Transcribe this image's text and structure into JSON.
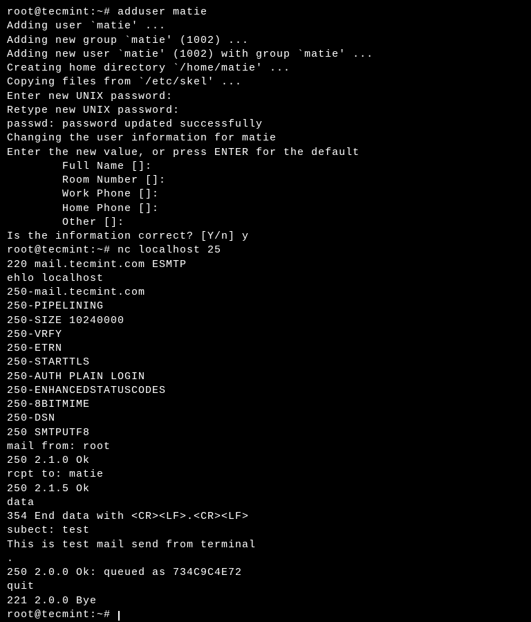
{
  "terminal": {
    "lines": [
      {
        "prompt": "root@tecmint:~# ",
        "command": "adduser matie",
        "output": null
      },
      {
        "prompt": null,
        "command": null,
        "output": "Adding user `matie' ..."
      },
      {
        "prompt": null,
        "command": null,
        "output": "Adding new group `matie' (1002) ..."
      },
      {
        "prompt": null,
        "command": null,
        "output": "Adding new user `matie' (1002) with group `matie' ..."
      },
      {
        "prompt": null,
        "command": null,
        "output": "Creating home directory `/home/matie' ..."
      },
      {
        "prompt": null,
        "command": null,
        "output": "Copying files from `/etc/skel' ..."
      },
      {
        "prompt": null,
        "command": null,
        "output": "Enter new UNIX password:"
      },
      {
        "prompt": null,
        "command": null,
        "output": "Retype new UNIX password:"
      },
      {
        "prompt": null,
        "command": null,
        "output": "passwd: password updated successfully"
      },
      {
        "prompt": null,
        "command": null,
        "output": "Changing the user information for matie"
      },
      {
        "prompt": null,
        "command": null,
        "output": "Enter the new value, or press ENTER for the default"
      },
      {
        "prompt": null,
        "command": null,
        "output": "        Full Name []:"
      },
      {
        "prompt": null,
        "command": null,
        "output": "        Room Number []:"
      },
      {
        "prompt": null,
        "command": null,
        "output": "        Work Phone []:"
      },
      {
        "prompt": null,
        "command": null,
        "output": "        Home Phone []:"
      },
      {
        "prompt": null,
        "command": null,
        "output": "        Other []:"
      },
      {
        "prompt": null,
        "command": null,
        "output": "Is the information correct? [Y/n] y"
      },
      {
        "prompt": "root@tecmint:~# ",
        "command": "nc localhost 25",
        "output": null
      },
      {
        "prompt": null,
        "command": null,
        "output": "220 mail.tecmint.com ESMTP"
      },
      {
        "prompt": null,
        "command": null,
        "output": "ehlo localhost"
      },
      {
        "prompt": null,
        "command": null,
        "output": "250-mail.tecmint.com"
      },
      {
        "prompt": null,
        "command": null,
        "output": "250-PIPELINING"
      },
      {
        "prompt": null,
        "command": null,
        "output": "250-SIZE 10240000"
      },
      {
        "prompt": null,
        "command": null,
        "output": "250-VRFY"
      },
      {
        "prompt": null,
        "command": null,
        "output": "250-ETRN"
      },
      {
        "prompt": null,
        "command": null,
        "output": "250-STARTTLS"
      },
      {
        "prompt": null,
        "command": null,
        "output": "250-AUTH PLAIN LOGIN"
      },
      {
        "prompt": null,
        "command": null,
        "output": "250-ENHANCEDSTATUSCODES"
      },
      {
        "prompt": null,
        "command": null,
        "output": "250-8BITMIME"
      },
      {
        "prompt": null,
        "command": null,
        "output": "250-DSN"
      },
      {
        "prompt": null,
        "command": null,
        "output": "250 SMTPUTF8"
      },
      {
        "prompt": null,
        "command": null,
        "output": "mail from: root"
      },
      {
        "prompt": null,
        "command": null,
        "output": "250 2.1.0 Ok"
      },
      {
        "prompt": null,
        "command": null,
        "output": "rcpt to: matie"
      },
      {
        "prompt": null,
        "command": null,
        "output": "250 2.1.5 Ok"
      },
      {
        "prompt": null,
        "command": null,
        "output": "data"
      },
      {
        "prompt": null,
        "command": null,
        "output": "354 End data with <CR><LF>.<CR><LF>"
      },
      {
        "prompt": null,
        "command": null,
        "output": "subect: test"
      },
      {
        "prompt": null,
        "command": null,
        "output": "This is test mail send from terminal"
      },
      {
        "prompt": null,
        "command": null,
        "output": "."
      },
      {
        "prompt": null,
        "command": null,
        "output": "250 2.0.0 Ok: queued as 734C9C4E72"
      },
      {
        "prompt": null,
        "command": null,
        "output": "quit"
      },
      {
        "prompt": null,
        "command": null,
        "output": "221 2.0.0 Bye"
      },
      {
        "prompt": "root@tecmint:~# ",
        "command": "",
        "output": null,
        "cursor": true
      }
    ]
  }
}
